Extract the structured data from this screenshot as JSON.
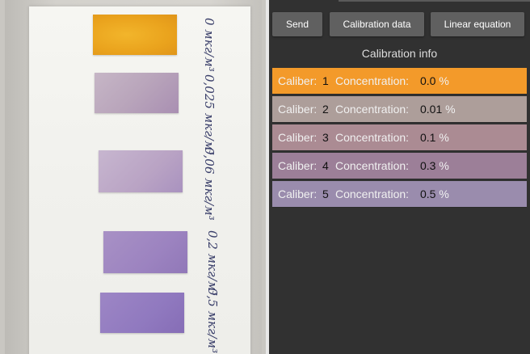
{
  "app": {
    "buttons": {
      "send": "Send",
      "calibration_data": "Calibration data",
      "linear_equation": "Linear equation"
    },
    "info_title": "Calibration info",
    "caliber_label": "Caliber:",
    "concentration_label": "Concentration:",
    "rows": [
      {
        "caliber": "1",
        "concentration": "0.0",
        "unit": "%",
        "color": "#f39a2a"
      },
      {
        "caliber": "2",
        "concentration": "0.01",
        "unit": "%",
        "color": "#ad9e9a"
      },
      {
        "caliber": "3",
        "concentration": "0.1",
        "unit": "%",
        "color": "#ab8b93"
      },
      {
        "caliber": "4",
        "concentration": "0.3",
        "unit": "%",
        "color": "#9c7f98"
      },
      {
        "caliber": "5",
        "concentration": "0.5",
        "unit": "%",
        "color": "#9a8cad"
      }
    ]
  },
  "photo": {
    "handwriting": [
      "0 мкг/м³",
      "0,025 мкг/м³",
      "0,06 мкг/м³",
      "0,2 мкг/м³",
      "0,5 мкг/м³"
    ]
  }
}
